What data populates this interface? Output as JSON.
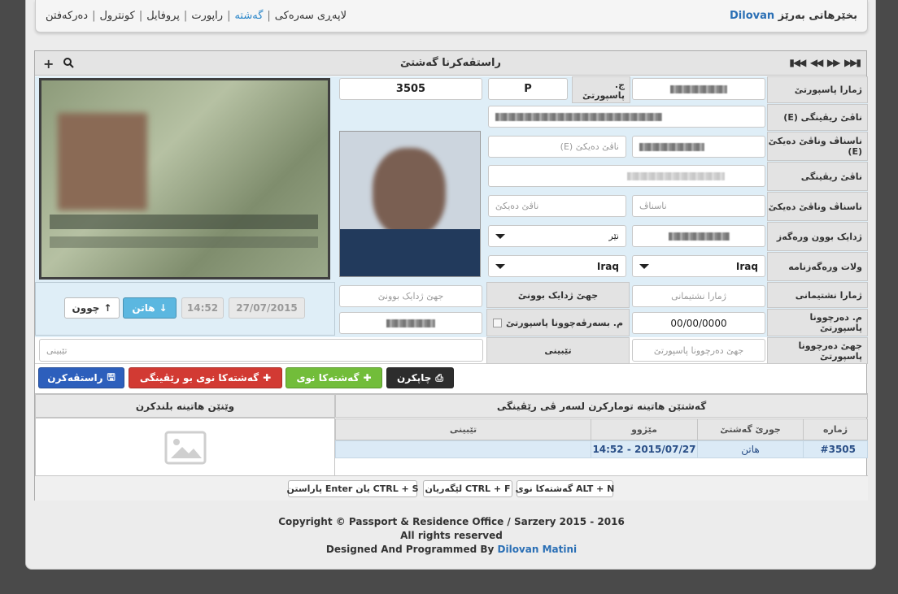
{
  "navbar": {
    "brand_prefix": "بخێرهاتی بەرێز",
    "brand_user": "Dilovan",
    "items": [
      "لاپەڕی سەرەکی",
      "گەشتە",
      "راپورت",
      "پروفایل",
      "کونترول",
      "دەرکەفتن"
    ],
    "separator": "|"
  },
  "panel": {
    "title": "راستڤەکرنا گەشتێ",
    "add_icon": "+",
    "search_icon": "search",
    "nav_icons": "⏮ ◀◀ ▶▶ ⏭"
  },
  "form": {
    "labels": {
      "passport_no": "ژمارا پاسپورتێ",
      "passport_type": "ج. پاسپورتێ",
      "name_e": "ناڤێ ریڤینگی (E)",
      "mother_name_e": "ناسناڤ وناڤێ دەیکێ (E)",
      "name": "ناڤێ ریڤینگی",
      "surname_mother": "ناسناڤ وناڤێ دەیکێ",
      "birth_date": "ژدایک بوون ورەگەز",
      "nationality": "ولات ورەگەزنامە",
      "id_no": "ژمارا نشتیمانی",
      "birth_place": "جهێ ژدایک بوونێ",
      "passport_issue": "م. دەرچوونا پاسپورتێ",
      "passport_expiry": "م. بسەرڤەچوونا پاسپورتێ",
      "passport_place": "جهێ دەرچوونا پاسپورتێ",
      "notes": "تێبینی"
    },
    "values": {
      "record_no": "3505",
      "passport_type": "P",
      "name_e": "SARBAST HINDI MAHMOOD",
      "mother_name_e": "MAHMOOD",
      "gender": "نێر",
      "country": "Iraq",
      "nationality": "Iraq",
      "issue_date": "00/00/0000"
    },
    "placeholders": {
      "mother_name_e": "ناڤێ دەیکێ (E)",
      "surname": "ناسناڤ",
      "mother_name": "ناڤێ دەیکێ",
      "id_no": "ژمارا نشتیمانی",
      "birth_place": "جهێ ژدایک بوونێ",
      "passport_place": "جهێ دەرچوونا پاسپورتێ",
      "notes": "تێبینی"
    },
    "expired_checkbox_label": "م. بسەرڤەچوونا پاسپورتێ"
  },
  "entry": {
    "date": "27/07/2015",
    "time": "14:52",
    "in_label": "هاتن",
    "out_label": "چوون"
  },
  "actions": {
    "print": "چاپکرن",
    "new_trip": "گەشتەکا نوی",
    "new_trip_traveler": "گەشتەکا نوی بو رێڤینگی",
    "save": "راستڤەکرن"
  },
  "history": {
    "title": "گەشتێن هاتینە تومارکرن لسەر ڤی رێڤینگی",
    "columns": [
      "ژمارە",
      "جورێ گەشتێ",
      "مێژوو",
      "تێبینی"
    ],
    "rows": [
      {
        "no": "#3505",
        "type": "هاتن",
        "date": "14:52 - 2015/07/27",
        "note": ""
      }
    ]
  },
  "upload": {
    "title": "وێنێن هاتینە بلندکرن"
  },
  "shortcuts": [
    "ALT + N گەشتەکا نوی",
    "CTRL + F لێگەریان",
    "CTRL + S یان Enter پاراستن"
  ],
  "footer": {
    "line1": "Copyright © Passport & Residence Office / Sarzery 2015 - 2016",
    "line2": "All rights reserved",
    "line3_prefix": "Designed And Programmed By",
    "line3_name": "Dilovan Matini"
  }
}
